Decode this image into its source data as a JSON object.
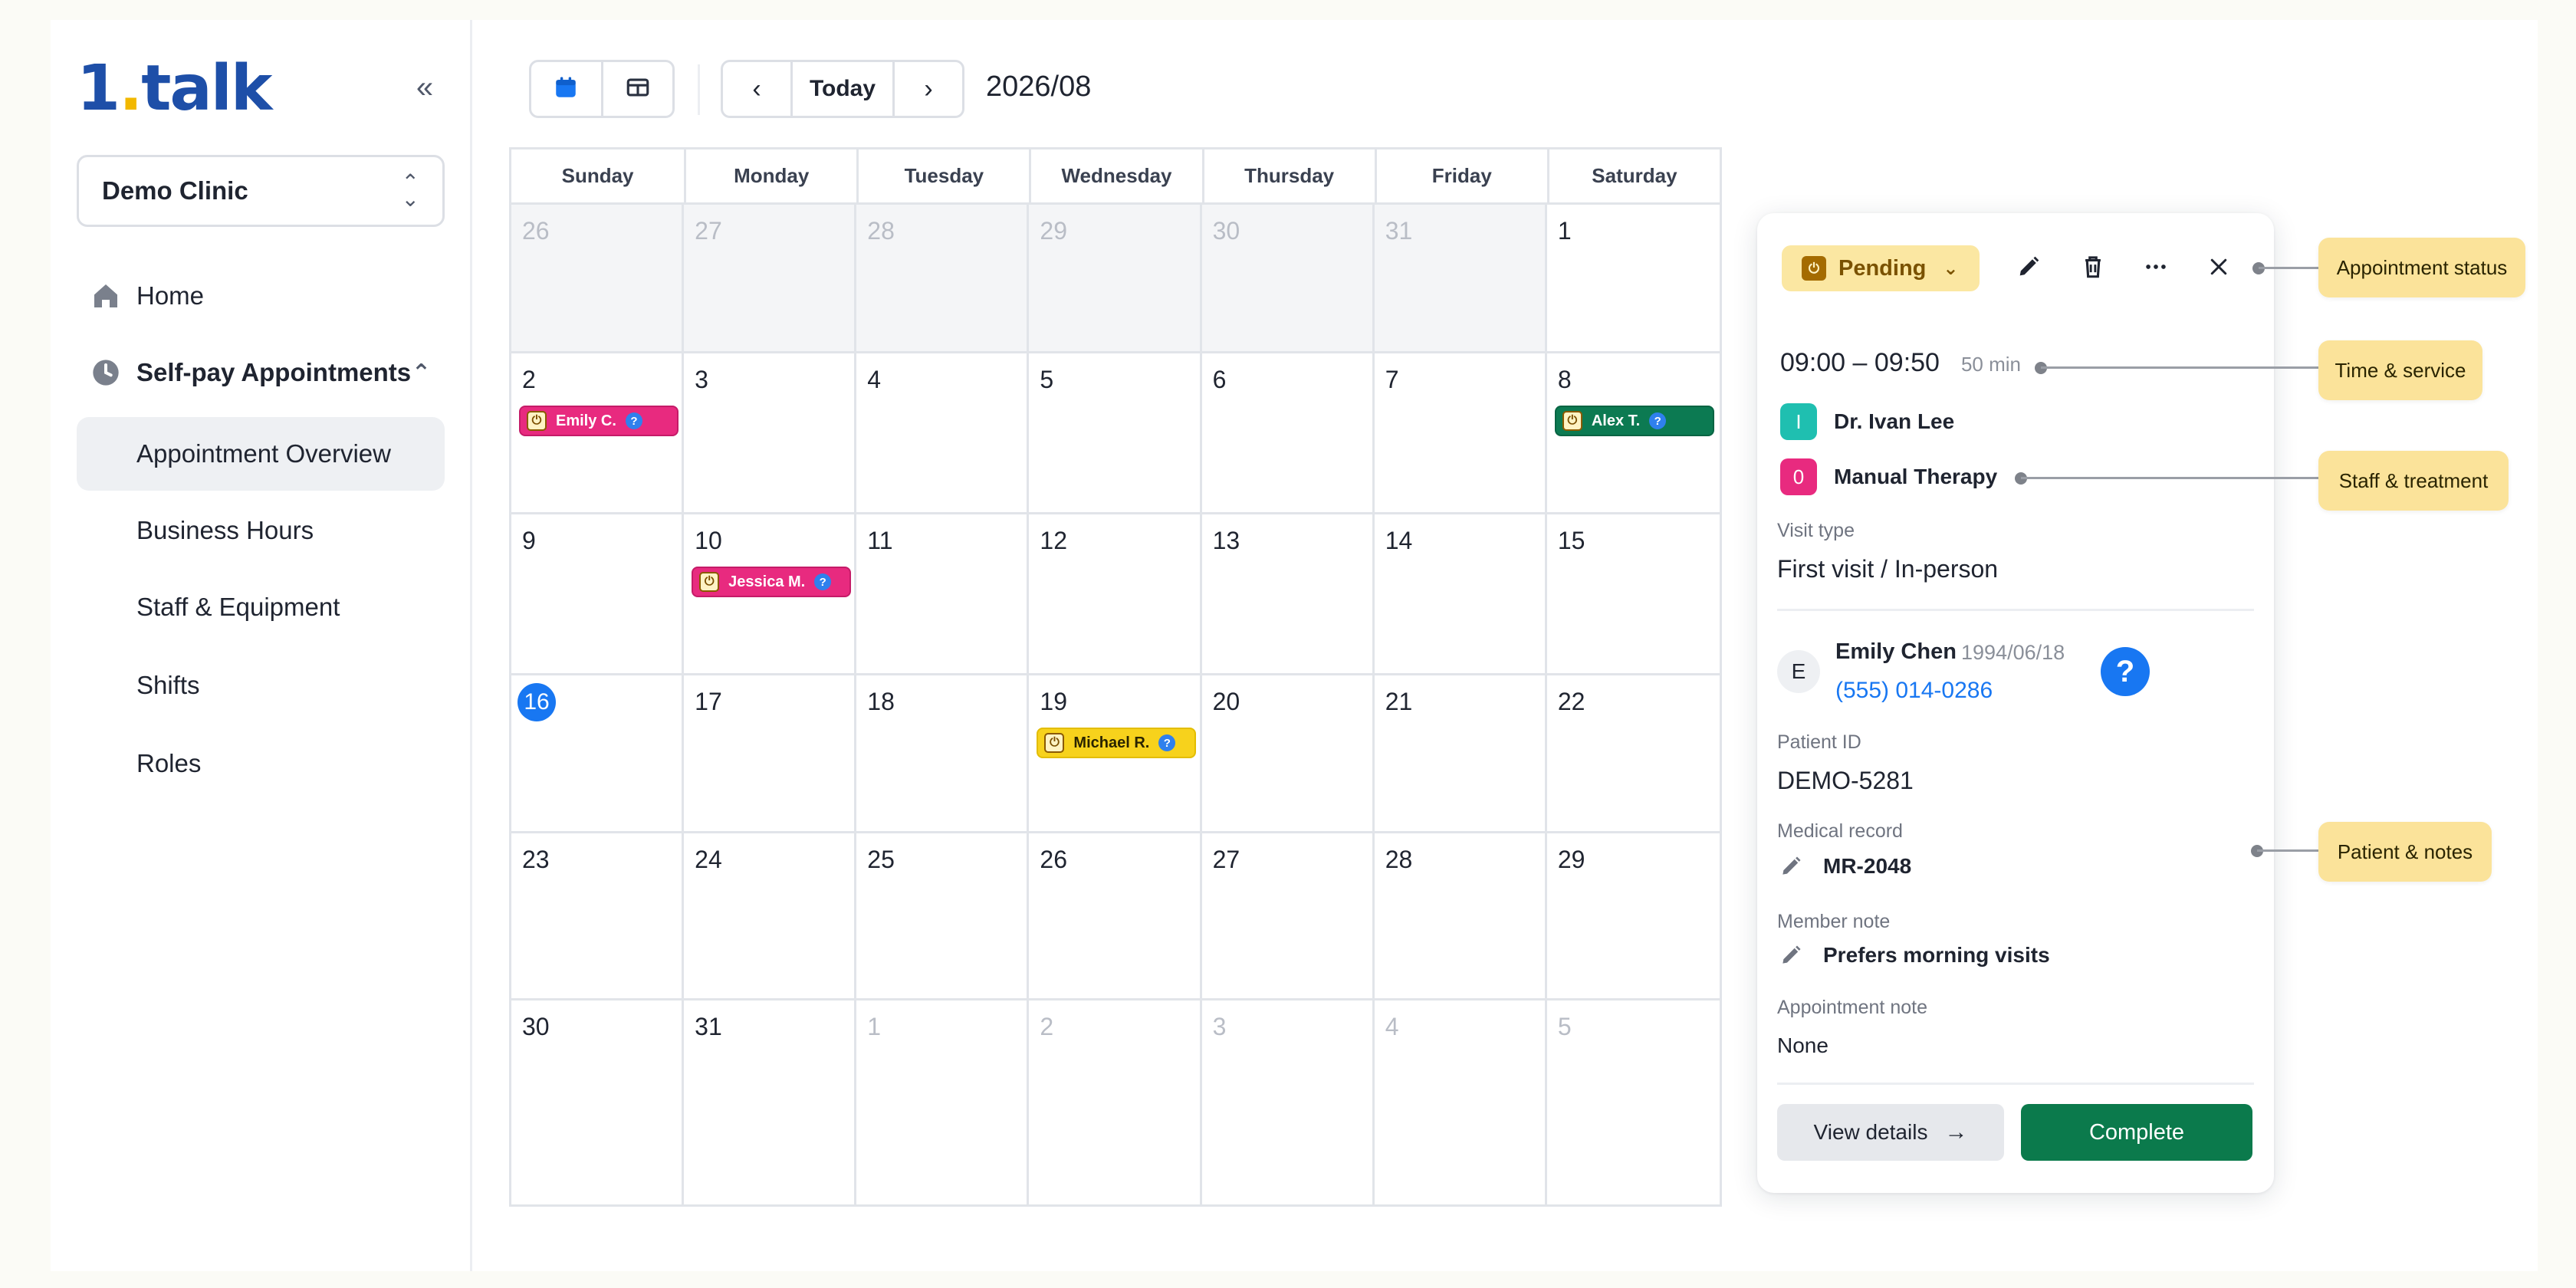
{
  "sidebar": {
    "logo_main": "1",
    "logo_dot": ".",
    "logo_rest": "talk",
    "collapse_glyph": "«",
    "clinic": "Demo Clinic",
    "nav": {
      "home": "Home",
      "selfpay": "Self-pay Appointments",
      "overview": "Appointment Overview",
      "hours": "Business Hours",
      "staff": "Staff & Equipment",
      "shifts": "Shifts",
      "roles": "Roles"
    }
  },
  "toolbar": {
    "today": "Today",
    "prev": "‹",
    "next": "›",
    "month": "2026/08"
  },
  "calendar": {
    "weekdays": [
      "Sunday",
      "Monday",
      "Tuesday",
      "Wednesday",
      "Thursday",
      "Friday",
      "Saturday"
    ],
    "weeks": [
      [
        "26",
        "27",
        "28",
        "29",
        "30",
        "31",
        "1"
      ],
      [
        "2",
        "3",
        "4",
        "5",
        "6",
        "7",
        "8"
      ],
      [
        "9",
        "10",
        "11",
        "12",
        "13",
        "14",
        "15"
      ],
      [
        "16",
        "17",
        "18",
        "19",
        "20",
        "21",
        "22"
      ],
      [
        "23",
        "24",
        "25",
        "26",
        "27",
        "28",
        "29"
      ],
      [
        "30",
        "31",
        "1",
        "2",
        "3",
        "4",
        "5"
      ]
    ],
    "events": {
      "emily": "Emily C.",
      "alex": "Alex T.",
      "jessica": "Jessica M.",
      "michael": "Michael R."
    },
    "colors": {
      "pink": "#e82a7f",
      "green": "#0c7a52",
      "yellow": "#f7d21c",
      "today": "#1877f2"
    }
  },
  "panel": {
    "status": "Pending",
    "time": "09:00 – 09:50",
    "duration": "50 min",
    "staff_initial": "I",
    "staff": "Dr. Ivan Lee",
    "treatment_initial": "0",
    "treatment": "Manual Therapy",
    "visit_type_label": "Visit type",
    "visit_type": "First visit / In-person",
    "patient_initial": "E",
    "patient_name": "Emily Chen",
    "patient_dob": "1994/06/18",
    "patient_phone": "(555) 014-0286",
    "patient_id_label": "Patient ID",
    "patient_id": "DEMO-5281",
    "record_label": "Medical record",
    "record": "MR-2048",
    "member_note_label": "Member note",
    "member_note": "Prefers morning visits",
    "appt_note_label": "Appointment note",
    "appt_note": "None",
    "view_details": "View details",
    "complete": "Complete"
  },
  "callouts": {
    "status": "Appointment status",
    "time": "Time & service",
    "staff": "Staff & treatment",
    "patient": "Patient & notes"
  }
}
